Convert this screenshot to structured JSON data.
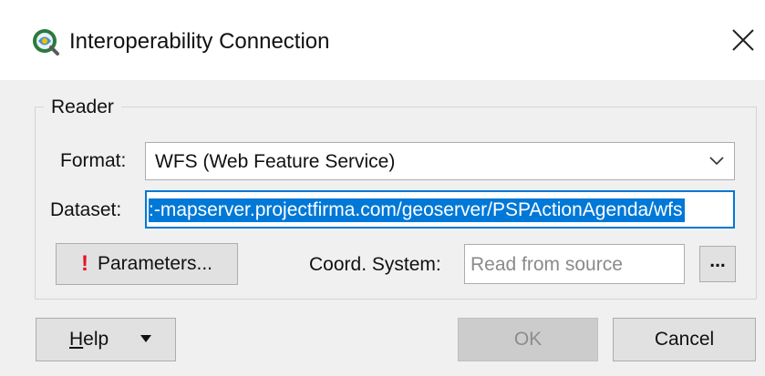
{
  "window": {
    "title": "Interoperability Connection",
    "close_symbol": "✕",
    "app_icon": "qgis-globe-icon"
  },
  "reader": {
    "group_label": "Reader",
    "format_label": "Format:",
    "format_value": "WFS (Web Feature Service)",
    "dataset_label": "Dataset:",
    "dataset_value": ":-mapserver.projectfirma.com/geoserver/PSPActionAgenda/wfs",
    "parameters_label": "Parameters...",
    "parameters_warning": "!",
    "coord_label": "Coord. System:",
    "coord_placeholder": "Read from source",
    "coord_browse_label": "..."
  },
  "footer": {
    "help_label_prefix": "H",
    "help_label_rest": "elp",
    "ok_label": "OK",
    "cancel_label": "Cancel"
  },
  "colors": {
    "selection": "#0078d7",
    "warning": "#e81123"
  }
}
